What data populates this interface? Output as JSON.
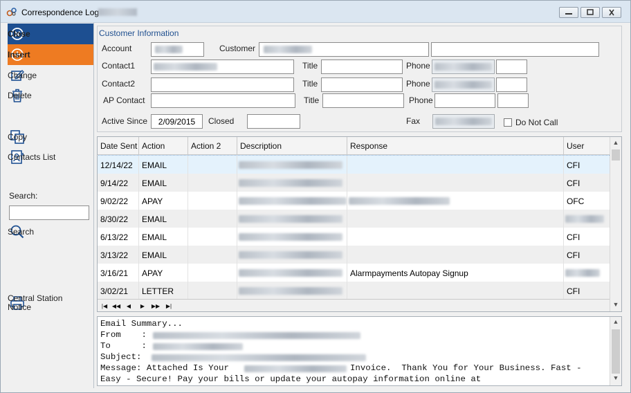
{
  "window": {
    "title": "Correspondence Log"
  },
  "sidebar": {
    "close": "Close",
    "insert": "Insert",
    "change": "Change",
    "delete": "Delete",
    "copy": "Copy",
    "contacts_list": "Contacts List",
    "search_label": "Search:",
    "search_value": "",
    "search_button": "Search",
    "central_station_line1": "Central Station",
    "central_station_line2": "Notice"
  },
  "customer_info": {
    "group_title": "Customer Information",
    "account_label": "Account",
    "customer_label": "Customer",
    "contact1_label": "Contact1",
    "contact2_label": "Contact2",
    "ap_contact_label": "AP Contact",
    "title_label": "Title",
    "phone_label": "Phone",
    "active_since_label": "Active Since",
    "active_since_value": "2/09/2015",
    "closed_label": "Closed",
    "closed_value": "",
    "fax_label": "Fax",
    "do_not_call_label": "Do Not Call"
  },
  "grid": {
    "columns": [
      "Date Sent",
      "Action",
      "Action 2",
      "Description",
      "Response",
      "User"
    ],
    "rows": [
      {
        "date": "12/14/22",
        "action": "EMAIL",
        "action2": "",
        "response": "",
        "user": "CFI"
      },
      {
        "date": "9/14/22",
        "action": "EMAIL",
        "action2": "",
        "response": "",
        "user": "CFI"
      },
      {
        "date": "9/02/22",
        "action": "APAY",
        "action2": "",
        "response": "",
        "user": "OFC"
      },
      {
        "date": "8/30/22",
        "action": "EMAIL",
        "action2": "",
        "response": "",
        "user": ""
      },
      {
        "date": "6/13/22",
        "action": "EMAIL",
        "action2": "",
        "response": "",
        "user": "CFI"
      },
      {
        "date": "3/13/22",
        "action": "EMAIL",
        "action2": "",
        "response": "",
        "user": "CFI"
      },
      {
        "date": "3/16/21",
        "action": "APAY",
        "action2": "",
        "response": "Alarmpayments Autopay Signup",
        "user": ""
      },
      {
        "date": "3/02/21",
        "action": "LETTER",
        "action2": "",
        "response": "",
        "user": "CFI"
      }
    ],
    "nav": [
      "|◀",
      "◀◀",
      "◀",
      "▶",
      "▶▶",
      "▶|"
    ]
  },
  "memo": {
    "line1": "Email Summary...",
    "from_label": "From    :",
    "to_label": "To      :",
    "subject_label": "Subject:",
    "message_prefix": "Message: Attached Is Your",
    "message_suffix": "Invoice.  Thank You for Your Business. Fast -",
    "line6": "Easy - Secure! Pay your bills or update your autopay information online at"
  },
  "colors": {
    "close_bg": "#1d4f91",
    "insert_bg": "#ee7b22",
    "group_title": "#1f4f8f"
  }
}
